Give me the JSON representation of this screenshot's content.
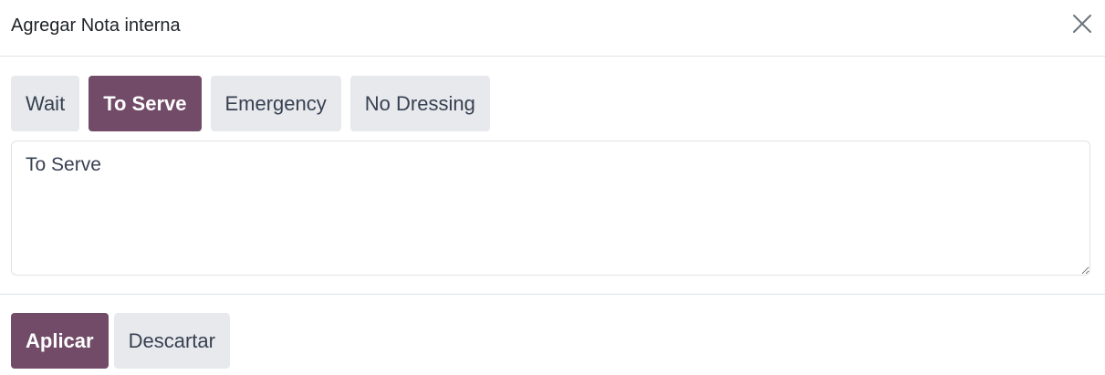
{
  "dialog": {
    "title": "Agregar Nota interna"
  },
  "presets": [
    {
      "label": "Wait",
      "active": false
    },
    {
      "label": "To Serve",
      "active": true
    },
    {
      "label": "Emergency",
      "active": false
    },
    {
      "label": "No Dressing",
      "active": false
    }
  ],
  "note": {
    "value": "To Serve"
  },
  "footer": {
    "apply_label": "Aplicar",
    "discard_label": "Descartar"
  },
  "colors": {
    "primary": "#714b67",
    "secondary": "#e7e9ed",
    "border": "#dee2e6"
  },
  "icons": {
    "close": "close-icon"
  }
}
